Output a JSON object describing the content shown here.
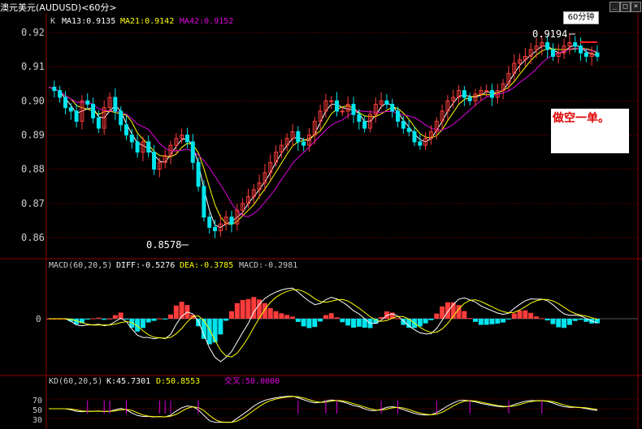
{
  "window": {
    "title": "澳元美元(AUDUSD)<60分>",
    "period_badge": "60分钟",
    "buttons": [
      "_",
      "□",
      "×"
    ]
  },
  "colors": {
    "background": "#000000",
    "up_candle": "#ff3c3c",
    "down_candle": "#00e5ee",
    "ma13": "#ffffff",
    "ma21": "#ffff00",
    "ma42": "#e000e0",
    "grid": "#8b0000",
    "axis_text": "#cccccc"
  },
  "main_panel": {
    "legend_k": "K",
    "ma13_label": "MA13:0.9135",
    "ma21_label": "MA21:0.9142",
    "ma42_label": "MA42:0.9152",
    "high_label": "0.9194",
    "low_label": "0.8578",
    "annotation": "做空一单。",
    "y_ticks": [
      "0.92",
      "0.91",
      "0.90",
      "0.89",
      "0.88",
      "0.87",
      "0.86"
    ]
  },
  "macd_panel": {
    "name": "MACD(60,20,5)",
    "diff": "DIFF:-0.5276",
    "dea": "DEA:-0.3785",
    "macd": "MACD:-0.2981",
    "y_tick": "0"
  },
  "kd_panel": {
    "name": "KD(60,20,5)",
    "k": "K:45.7301",
    "d": "D:50.8553",
    "cross": "交叉:50.0000",
    "y_ticks": [
      "70",
      "50",
      "30"
    ]
  },
  "chart_data": {
    "type": "candlestick",
    "instrument": "AUDUSD",
    "timeframe": "60分",
    "ylim": [
      0.855,
      0.925
    ],
    "ytick_values": [
      0.92,
      0.91,
      0.9,
      0.89,
      0.88,
      0.87,
      0.86
    ],
    "high_marker": 0.9194,
    "low_marker": 0.8578,
    "close_path": [
      0.904,
      0.903,
      0.901,
      0.898,
      0.897,
      0.894,
      0.9,
      0.899,
      0.895,
      0.892,
      0.898,
      0.901,
      0.897,
      0.893,
      0.89,
      0.888,
      0.885,
      0.888,
      0.885,
      0.88,
      0.882,
      0.884,
      0.887,
      0.889,
      0.89,
      0.888,
      0.882,
      0.875,
      0.866,
      0.863,
      0.862,
      0.864,
      0.866,
      0.864,
      0.868,
      0.87,
      0.872,
      0.874,
      0.876,
      0.879,
      0.882,
      0.885,
      0.887,
      0.889,
      0.891,
      0.888,
      0.887,
      0.89,
      0.894,
      0.897,
      0.9,
      0.9,
      0.897,
      0.897,
      0.899,
      0.896,
      0.894,
      0.892,
      0.896,
      0.899,
      0.9,
      0.899,
      0.897,
      0.894,
      0.892,
      0.891,
      0.888,
      0.887,
      0.889,
      0.891,
      0.894,
      0.897,
      0.9,
      0.901,
      0.903,
      0.901,
      0.9,
      0.902,
      0.903,
      0.903,
      0.901,
      0.903,
      0.905,
      0.908,
      0.911,
      0.912,
      0.913,
      0.915,
      0.916,
      0.917,
      0.915,
      0.913,
      0.914,
      0.916,
      0.917,
      0.916,
      0.914,
      0.913,
      0.914,
      0.913
    ],
    "series": [
      {
        "name": "MA13",
        "value": 0.9135
      },
      {
        "name": "MA21",
        "value": 0.9142
      },
      {
        "name": "MA42",
        "value": 0.9152
      }
    ]
  }
}
